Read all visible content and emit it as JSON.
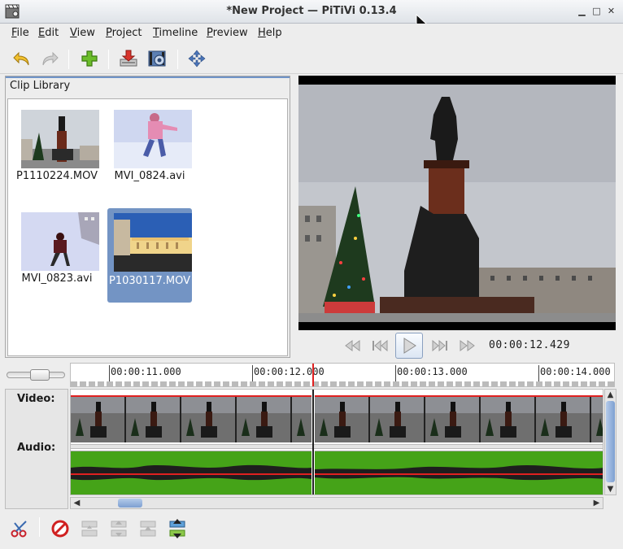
{
  "window": {
    "title": "*New Project — PiTiVi 0.13.4"
  },
  "menu": [
    {
      "accel": "F",
      "rest": "ile"
    },
    {
      "accel": "E",
      "rest": "dit"
    },
    {
      "accel": "V",
      "rest": "iew"
    },
    {
      "accel": "P",
      "rest": "roject"
    },
    {
      "accel": "T",
      "rest": "imeline"
    },
    {
      "accel": "P",
      "rest": "review"
    },
    {
      "accel": "H",
      "rest": "elp"
    }
  ],
  "toolbar": {
    "icons": [
      "undo-icon",
      "redo-icon",
      "import-clips-icon",
      "render-icon",
      "project-settings-icon",
      "fullscreen-icon"
    ]
  },
  "library": {
    "title": "Clip Library",
    "clips": [
      {
        "name": "P1110224.MOV"
      },
      {
        "name": "MVI_0824.avi"
      },
      {
        "name": "MVI_0823.avi"
      },
      {
        "name": "P1030117.MOV",
        "selected": true
      }
    ]
  },
  "viewer": {
    "timecode": "00:00:12.429"
  },
  "timeline": {
    "ruler_labels": [
      "00:00:11.000",
      "00:00:12.000",
      "00:00:13.000",
      "00:00:14.000"
    ],
    "video_label": "Video:",
    "audio_label": "Audio:"
  },
  "bottom_toolbar": {
    "icons": [
      "split-icon",
      "delete-icon",
      "unlink-icon",
      "link-icon",
      "ungroup-icon",
      "group-icon"
    ]
  },
  "colors": {
    "selection": "#7394c4",
    "playhead": "#e02020",
    "audio_waveform_bg": "#45a318"
  }
}
